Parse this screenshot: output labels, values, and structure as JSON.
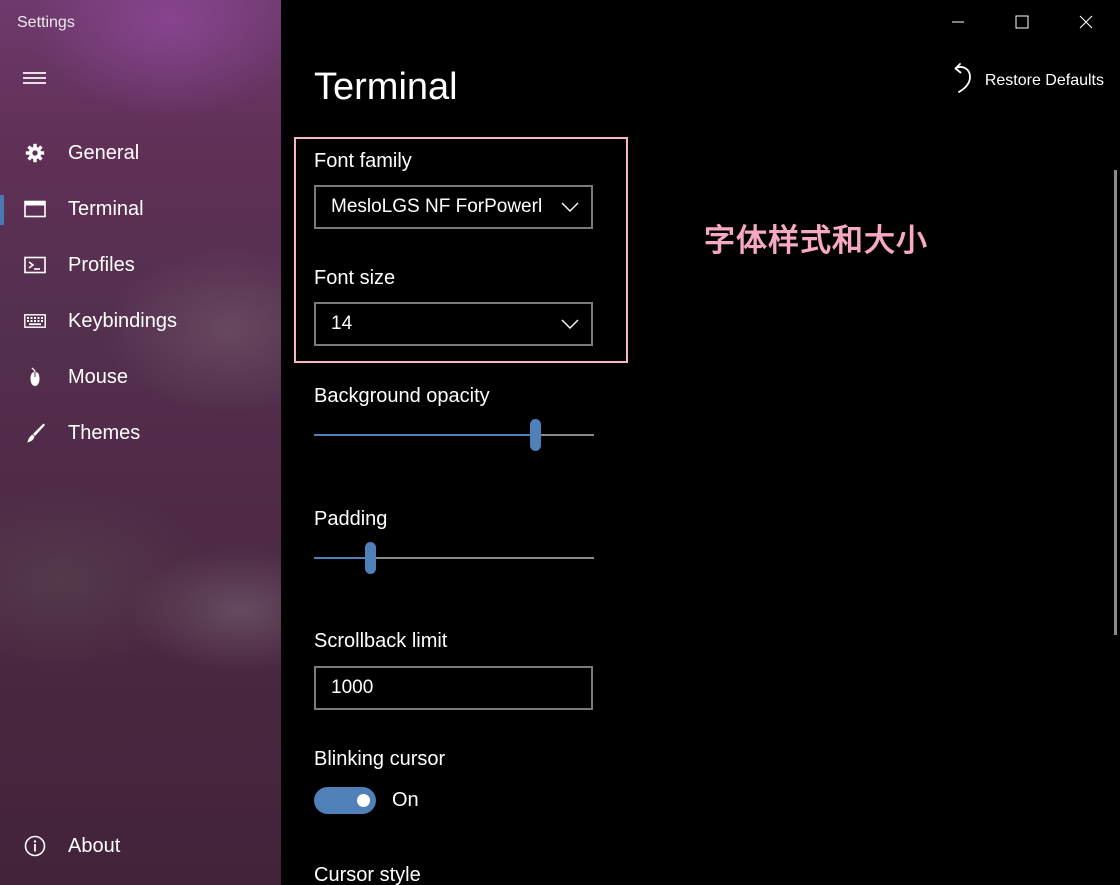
{
  "app": {
    "title": "Settings"
  },
  "window_controls": {
    "minimize_icon": "minimize-icon",
    "maximize_icon": "maximize-icon",
    "close_icon": "close-icon"
  },
  "sidebar": {
    "menu_icon": "hamburger-icon",
    "items": [
      {
        "label": "General",
        "icon": "gear-icon",
        "selected": false
      },
      {
        "label": "Terminal",
        "icon": "window-icon",
        "selected": true
      },
      {
        "label": "Profiles",
        "icon": "console-prompt-icon",
        "selected": false
      },
      {
        "label": "Keybindings",
        "icon": "keyboard-icon",
        "selected": false
      },
      {
        "label": "Mouse",
        "icon": "mouse-icon",
        "selected": false
      },
      {
        "label": "Themes",
        "icon": "brush-icon",
        "selected": false
      }
    ],
    "about": {
      "label": "About",
      "icon": "info-icon"
    }
  },
  "page": {
    "title": "Terminal",
    "restore_defaults": "Restore Defaults",
    "annotation": "字体样式和大小",
    "font_family": {
      "label": "Font family",
      "value": "MesloLGS NF ForPowerl"
    },
    "font_size": {
      "label": "Font size",
      "value": "14"
    },
    "background_opacity": {
      "label": "Background opacity",
      "fraction": 0.79
    },
    "padding": {
      "label": "Padding",
      "fraction": 0.2
    },
    "scrollback_limit": {
      "label": "Scrollback limit",
      "value": "1000"
    },
    "blinking_cursor": {
      "label": "Blinking cursor",
      "state": "On"
    },
    "cursor_style": {
      "label": "Cursor style"
    }
  },
  "colors": {
    "accent": "#4f81b8",
    "annotation": "#f7a9c4",
    "highlight_border": "#f7b7c8"
  }
}
